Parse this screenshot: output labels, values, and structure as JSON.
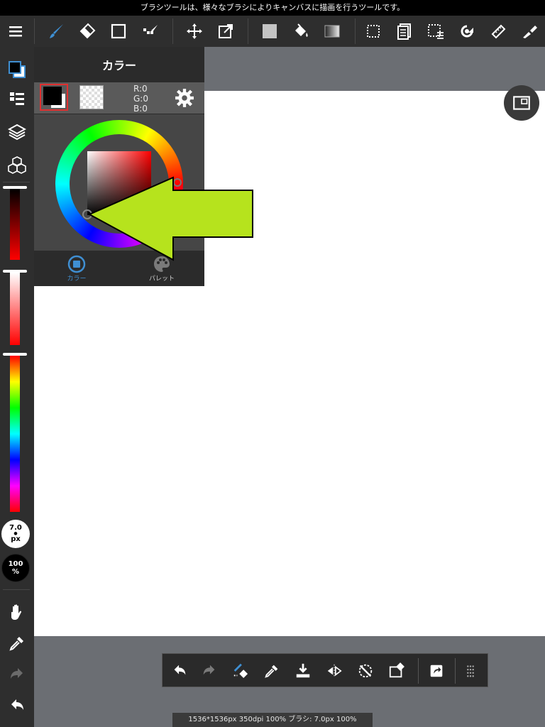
{
  "hint": "ブラシツールは、様々なブラシによりキャンバスに描画を行うツールです。",
  "toolbar": {
    "tools": [
      {
        "name": "menu-icon"
      },
      {
        "name": "brush-icon",
        "active": true
      },
      {
        "name": "eraser-icon"
      },
      {
        "name": "shape-icon"
      },
      {
        "name": "dot-icon"
      },
      {
        "name": "move-icon"
      },
      {
        "name": "transform-icon"
      },
      {
        "name": "fill-color-icon"
      },
      {
        "name": "bucket-icon"
      },
      {
        "name": "gradient-icon"
      },
      {
        "name": "select-icon"
      },
      {
        "name": "layer-copy-icon"
      },
      {
        "name": "select-menu-icon"
      },
      {
        "name": "rotate-icon"
      },
      {
        "name": "ruler-icon"
      },
      {
        "name": "text-icon"
      }
    ]
  },
  "color_panel": {
    "title": "カラー",
    "rgb": {
      "r": "R:0",
      "g": "G:0",
      "b": "B:0"
    },
    "tabs": [
      {
        "label": "カラー",
        "active": true
      },
      {
        "label": "パレット",
        "active": false
      }
    ],
    "accent": "#3f8fd2"
  },
  "left": {
    "brush_size": {
      "value": "7.0",
      "unit": "px"
    },
    "opacity": {
      "value": "100",
      "unit": "%"
    }
  },
  "bottom_tools": [
    {
      "name": "undo-icon"
    },
    {
      "name": "redo-icon"
    },
    {
      "name": "brush-erase-toggle-icon"
    },
    {
      "name": "eyedropper-icon"
    },
    {
      "name": "save-icon"
    },
    {
      "name": "flip-icon"
    },
    {
      "name": "rotate-reset-icon"
    },
    {
      "name": "clear-icon"
    },
    {
      "name": "share-icon"
    },
    {
      "name": "more-icon"
    }
  ],
  "status": "1536*1536px 350dpi 100% ブラシ: 7.0px 100%",
  "colors": {
    "toolbar_bg": "#2e2e2e",
    "canvas_bg": "#6b6e73",
    "canvas": "#ffffff",
    "arrow": "#b6e31d",
    "selected_outline": "#e03030"
  }
}
